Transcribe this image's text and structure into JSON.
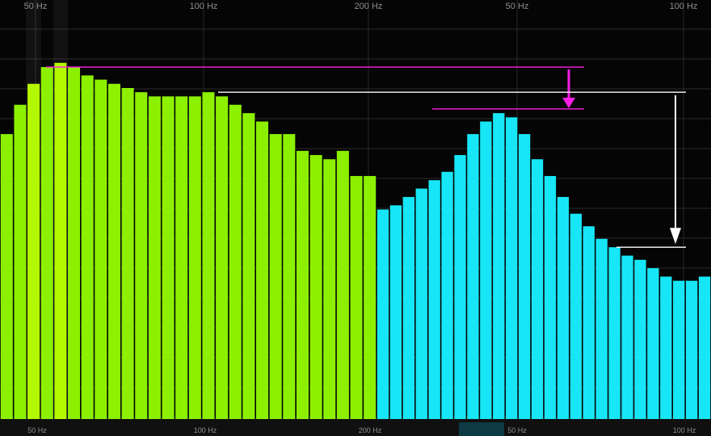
{
  "window": {
    "title": ""
  },
  "top_axis_labels": [
    "50 Hz",
    "100 Hz",
    "200 Hz",
    "50 Hz",
    "100 Hz"
  ],
  "bottom_axis_labels": [
    "50 Hz",
    "100 Hz",
    "200 Hz",
    "50 Hz",
    "100 Hz"
  ],
  "colors": {
    "background": "#050505",
    "grid": "#2a2a2a",
    "series_1": "#8cf000",
    "series_1_highlight": "#b4f800",
    "series_2": "#17e6f6",
    "marker_magenta": "#ff1ee6",
    "marker_white": "#ffffff"
  },
  "chart_data": {
    "type": "bar",
    "title": "",
    "xlabel": "",
    "ylabel": "",
    "ylim": [
      0,
      100
    ],
    "grid": true,
    "legend": "none",
    "series": [
      {
        "values": [
          68,
          75,
          80,
          84,
          85,
          84,
          82,
          81,
          80,
          79,
          78,
          77,
          77,
          77,
          77,
          78,
          77,
          75,
          73,
          71,
          68,
          68,
          64,
          63,
          62,
          64,
          58,
          58
        ]
      },
      {
        "values": [
          50,
          51,
          53,
          55,
          57,
          59,
          63,
          68,
          71,
          73,
          72,
          68,
          62,
          58,
          53,
          49,
          46,
          43,
          41,
          39,
          38,
          36,
          34,
          33,
          33,
          34
        ]
      }
    ],
    "highlight_bars_series_1": [
      2,
      4
    ],
    "reference_lines": [
      {
        "color": "magenta",
        "from": 84,
        "to": 74
      },
      {
        "color": "white",
        "from": 78,
        "to": 41
      }
    ]
  }
}
